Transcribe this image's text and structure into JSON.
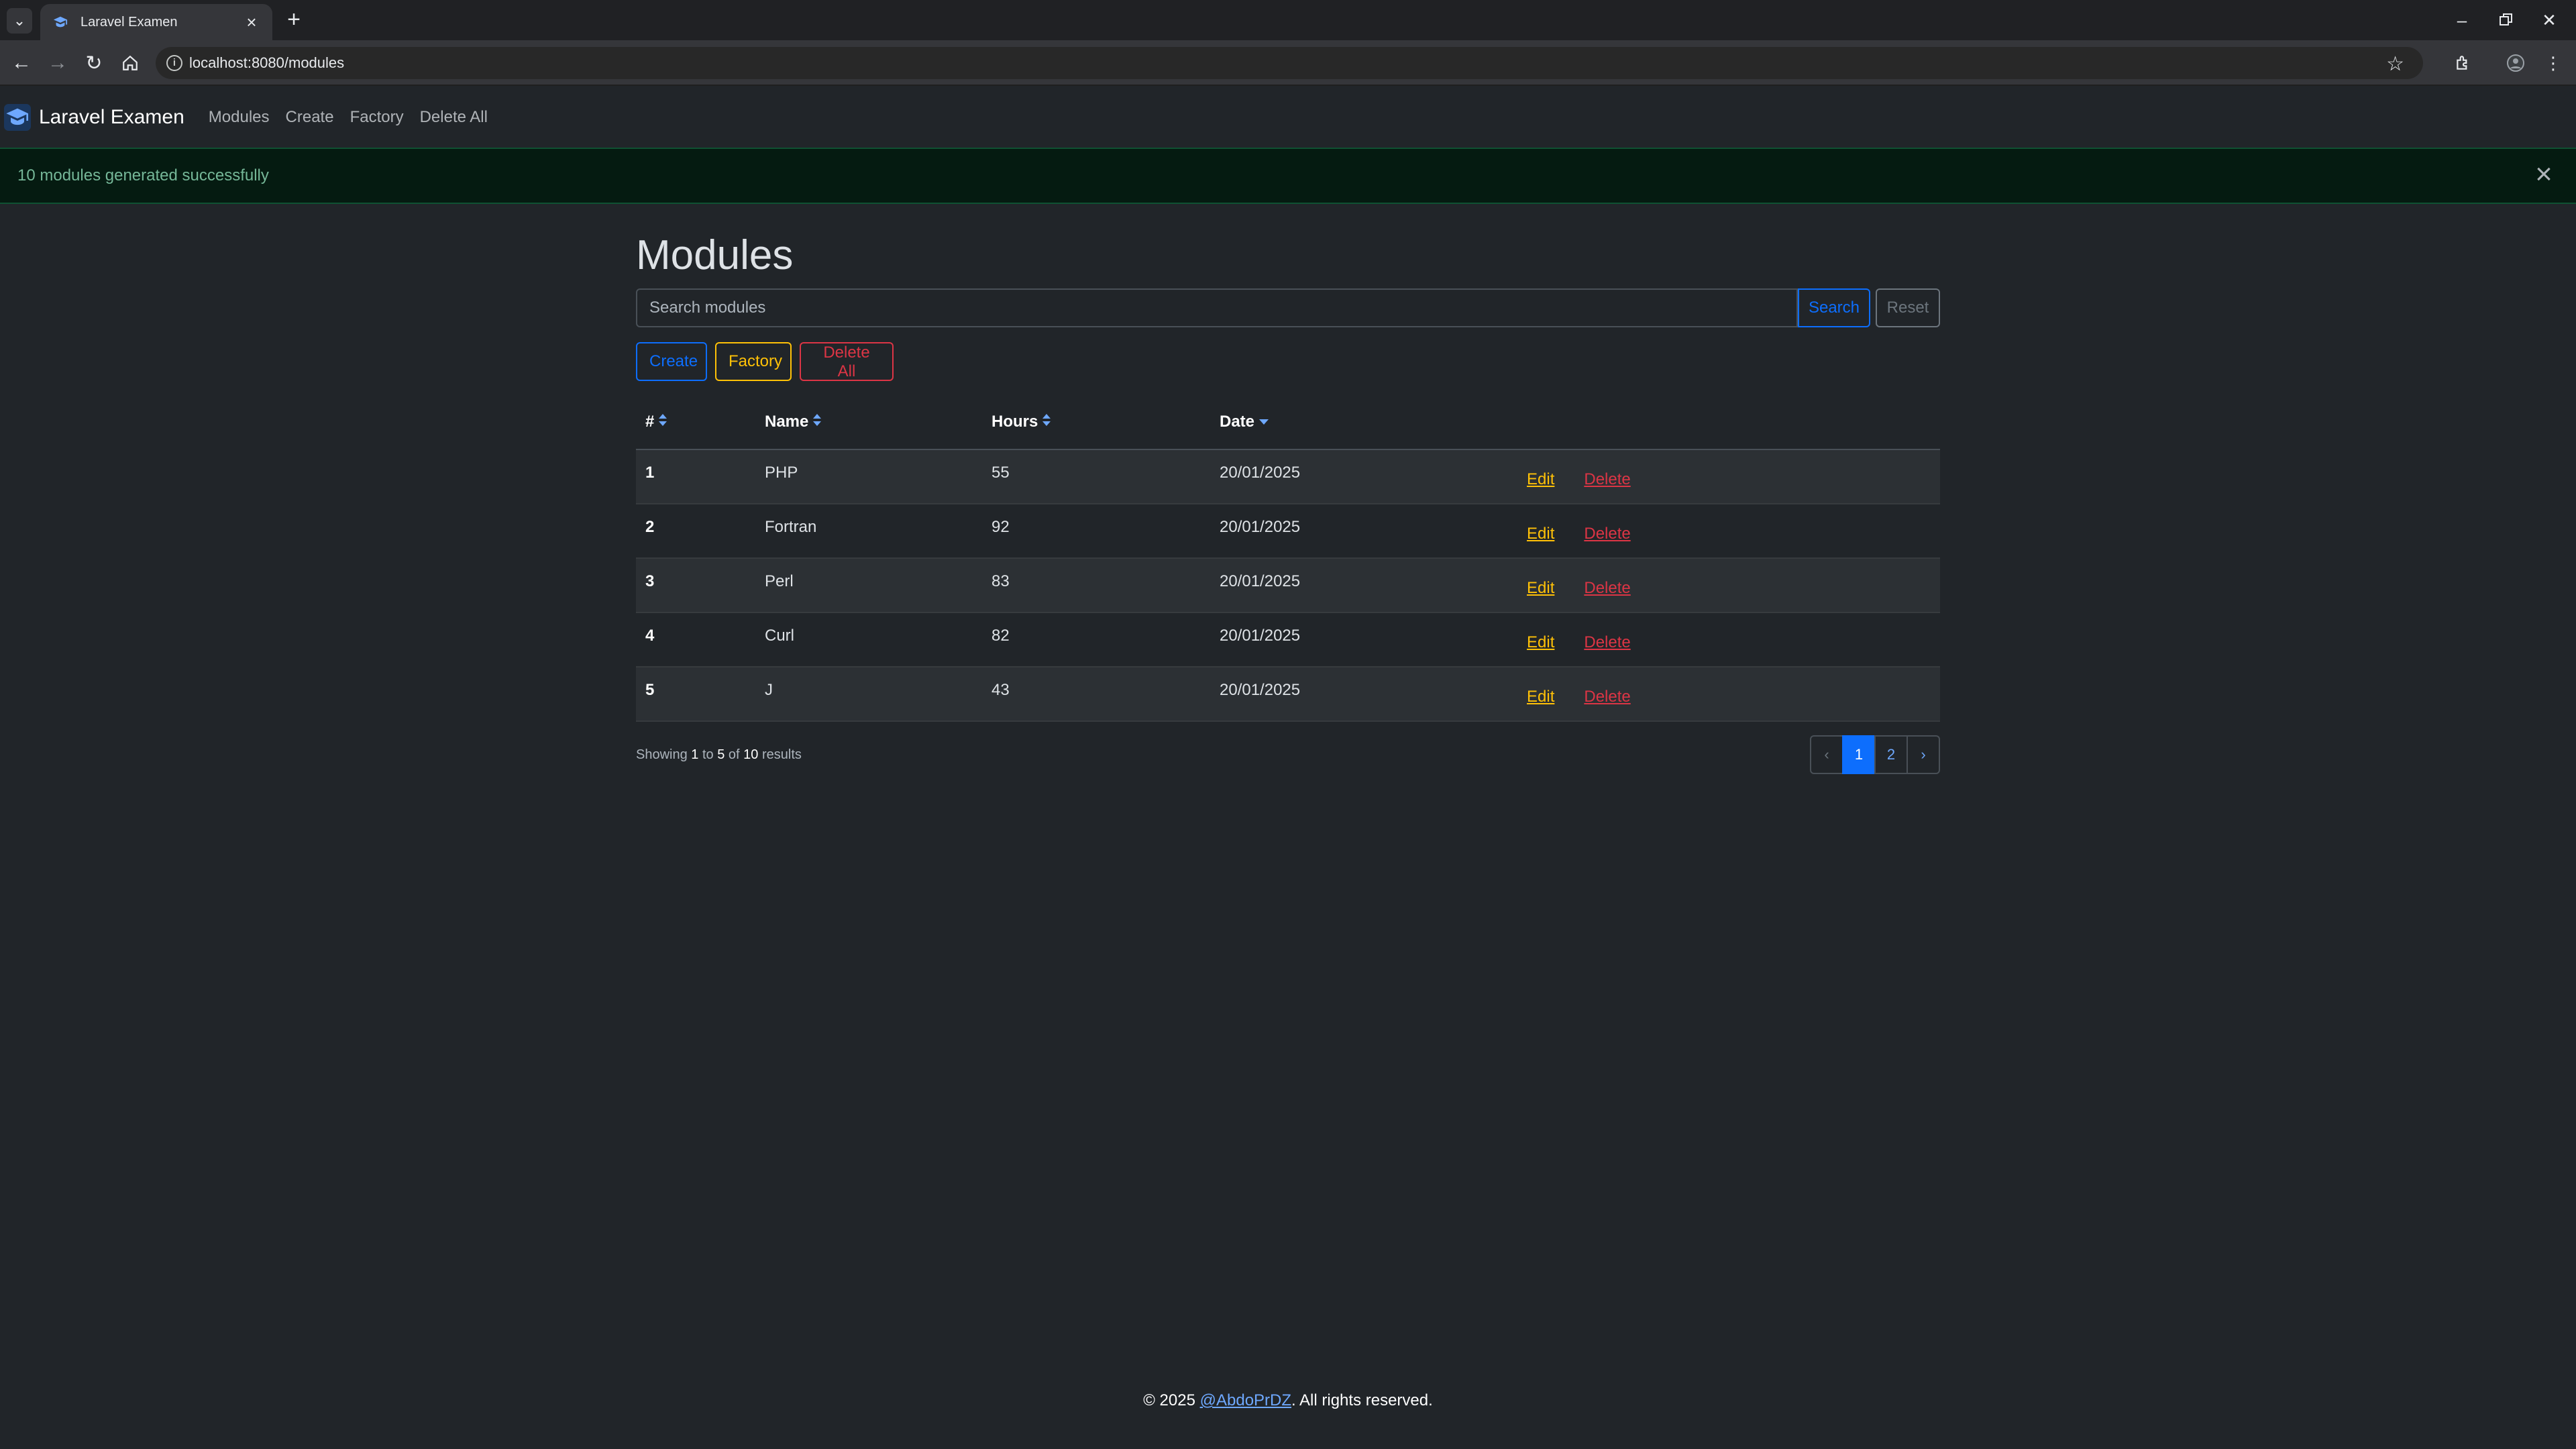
{
  "browser": {
    "tab_title": "Laravel Examen",
    "url": "localhost:8080/modules",
    "icons": [
      "tab-list-icon",
      "close-icon",
      "new-tab-icon",
      "minimize-icon",
      "restore-icon",
      "back-icon",
      "forward-icon",
      "reload-icon",
      "home-icon",
      "info-icon",
      "star-icon",
      "extensions-icon",
      "profile-icon",
      "menu-icon"
    ]
  },
  "navbar": {
    "brand": "Laravel Examen",
    "links": [
      "Modules",
      "Create",
      "Factory",
      "Delete All"
    ]
  },
  "alert": {
    "message": "10 modules generated successfully"
  },
  "page": {
    "title": "Modules",
    "search_placeholder": "Search modules",
    "search_button": "Search",
    "reset_button": "Reset",
    "create_button": "Create",
    "factory_button": "Factory",
    "delete_all_button": "Delete All"
  },
  "table": {
    "headers": [
      "#",
      "Name",
      "Hours",
      "Date"
    ],
    "rows": [
      {
        "id": "1",
        "name": "PHP",
        "hours": "55",
        "date": "20/01/2025"
      },
      {
        "id": "2",
        "name": "Fortran",
        "hours": "92",
        "date": "20/01/2025"
      },
      {
        "id": "3",
        "name": "Perl",
        "hours": "83",
        "date": "20/01/2025"
      },
      {
        "id": "4",
        "name": "Curl",
        "hours": "82",
        "date": "20/01/2025"
      },
      {
        "id": "5",
        "name": "J",
        "hours": "43",
        "date": "20/01/2025"
      }
    ],
    "edit_label": "Edit",
    "delete_label": "Delete"
  },
  "pagination": {
    "showing_prefix": "Showing",
    "from": "1",
    "to_word": "to",
    "to": "5",
    "of_word": "of",
    "total": "10",
    "results_word": "results",
    "prev": "‹",
    "pages": [
      "1",
      "2"
    ],
    "next": "›"
  },
  "footer": {
    "prefix": "© 2025 ",
    "link": "@AbdoPrDZ",
    "suffix": ". All rights reserved."
  },
  "colors": {
    "background": "#212529",
    "primary": "#0d6efd",
    "warning": "#ffc107",
    "danger": "#dc3545",
    "success_text": "#75b798"
  }
}
